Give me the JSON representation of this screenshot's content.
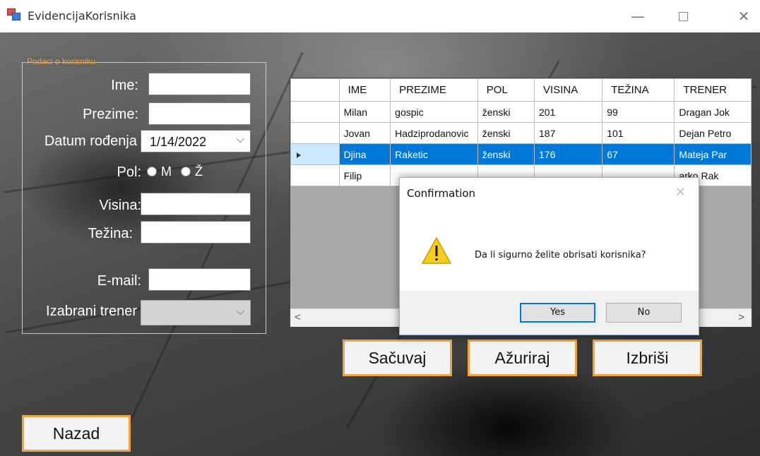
{
  "window": {
    "title": "EvidencijaKorisnika",
    "min_glyph": "—",
    "close_glyph": "✕"
  },
  "group": {
    "title": "Podaci o korisniku"
  },
  "form": {
    "ime_label": "Ime:",
    "prezime_label": "Prezime:",
    "datum_label": "Datum rođenja",
    "datum_value": "1/14/2022",
    "pol_label": "Pol:",
    "pol_m": "M",
    "pol_z": "Ž",
    "visina_label": "Visina:",
    "tezina_label": "Težina:",
    "email_label": "E-mail:",
    "trener_label": "Izabrani trener",
    "chevron": "⌵"
  },
  "grid": {
    "columns": [
      "IME",
      "PREZIME",
      "POL",
      "VISINA",
      "TEŽINA",
      "TRENER"
    ],
    "rows": [
      [
        "Milan",
        "gospic",
        "ženski",
        "201",
        "99",
        "Dragan Jok"
      ],
      [
        "Jovan",
        "Hadziprodanovic",
        "ženski",
        "187",
        "101",
        "Dejan Petro"
      ],
      [
        "Djina",
        "Raketic",
        "ženski",
        "176",
        "67",
        "Mateja Par"
      ],
      [
        "Filip",
        "",
        "",
        "",
        "",
        "arko Rak"
      ]
    ],
    "selected_row": 2,
    "scroll_left": "<",
    "scroll_right": ">"
  },
  "buttons": {
    "save": "Sačuvaj",
    "update": "Ažuriraj",
    "delete": "Izbriši",
    "back": "Nazad"
  },
  "dialog": {
    "title": "Confirmation",
    "close": "✕",
    "message": "Da li sigurno želite obrisati korisnika?",
    "yes": "Yes",
    "no": "No"
  },
  "colors": {
    "accent": "#f0a43a",
    "selection": "#0078d7",
    "dialog_default": "#0078d7"
  }
}
